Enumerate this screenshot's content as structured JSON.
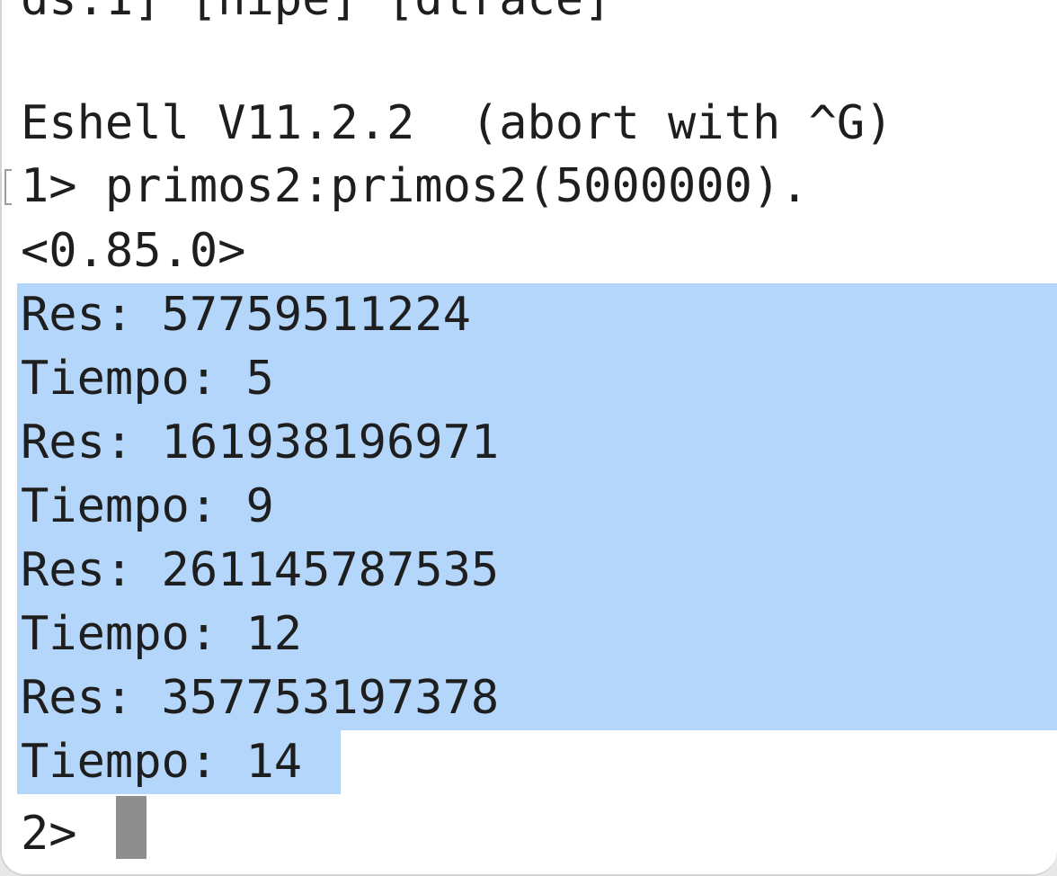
{
  "terminal": {
    "top_partial_line": "ds:1] [hipe] [dtrace]",
    "banner": "Eshell V11.2.2  (abort with ^G)",
    "command_line": "1> primos2:primos2(5000000).",
    "pid_output": "<0.85.0>",
    "selected_output": [
      "Res: 57759511224",
      "Tiempo: 5",
      "Res: 161938196971",
      "Tiempo: 9",
      "Res: 261145787535",
      "Tiempo: 12",
      "Res: 357753197378",
      "Tiempo: 14"
    ],
    "next_prompt": "2> "
  },
  "colors": {
    "background": "#ffffff",
    "text": "#1e1e1e",
    "selection": "#b4d6fb",
    "cursor": "#8e8e8e"
  }
}
